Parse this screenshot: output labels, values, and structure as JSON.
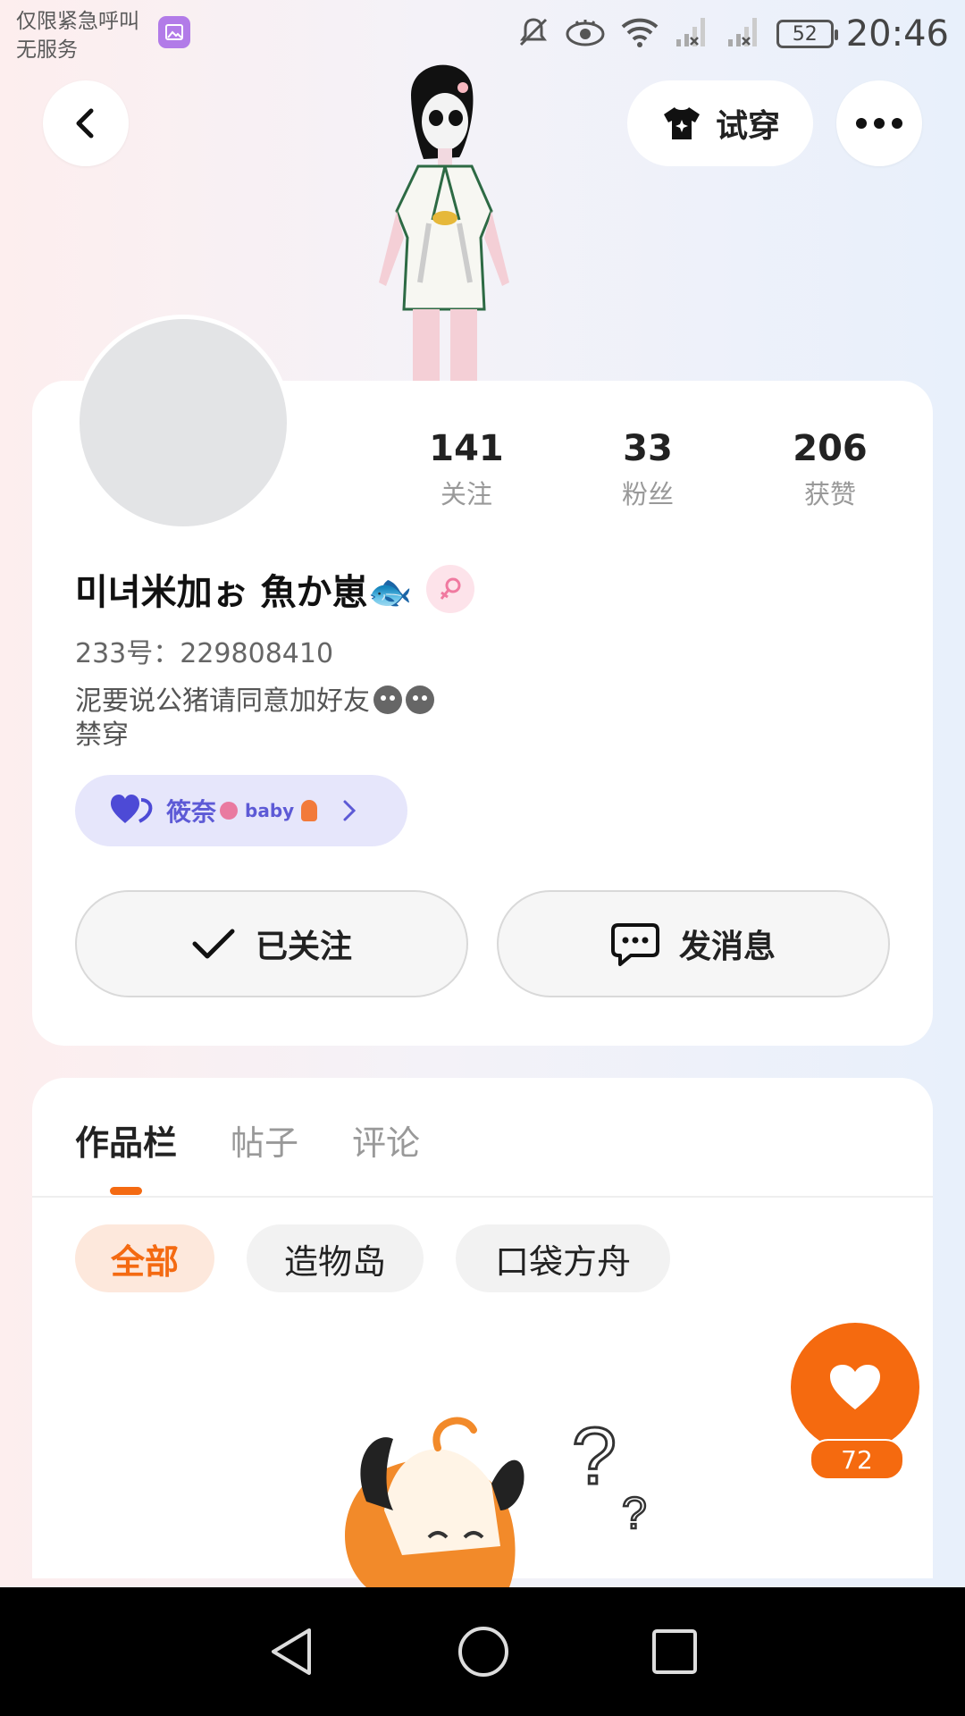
{
  "status_bar": {
    "carrier_line1": "仅限紧急呼叫",
    "carrier_line2": "无服务",
    "battery": "52",
    "time": "20:46",
    "icons": [
      "gallery-icon",
      "mute-icon",
      "eye-icon",
      "wifi-icon",
      "signal-icon",
      "battery-icon"
    ]
  },
  "header": {
    "try_on_label": "试穿"
  },
  "profile": {
    "stats": [
      {
        "value": "141",
        "label": "关注"
      },
      {
        "value": "33",
        "label": "粉丝"
      },
      {
        "value": "206",
        "label": "获赞"
      }
    ],
    "name": "미녀米加ぉ 魚か崽🐟",
    "uid": "233号：229808410",
    "bio_line1": "泥要说公猪请同意加好友",
    "bio_line2": "禁穿",
    "cp_name": "筱奈",
    "cp_suffix": "baby",
    "follow_label": "已关注",
    "message_label": "发消息"
  },
  "tabs": [
    {
      "label": "作品栏",
      "active": true
    },
    {
      "label": "帖子",
      "active": false
    },
    {
      "label": "评论",
      "active": false
    }
  ],
  "chips": [
    {
      "label": "全部",
      "active": true
    },
    {
      "label": "造物岛",
      "active": false
    },
    {
      "label": "口袋方舟",
      "active": false
    }
  ],
  "like_count": "72",
  "colors": {
    "accent": "#f56a0f",
    "cp_bg": "#e6e6fb",
    "cp_text": "#5d5ad6"
  }
}
